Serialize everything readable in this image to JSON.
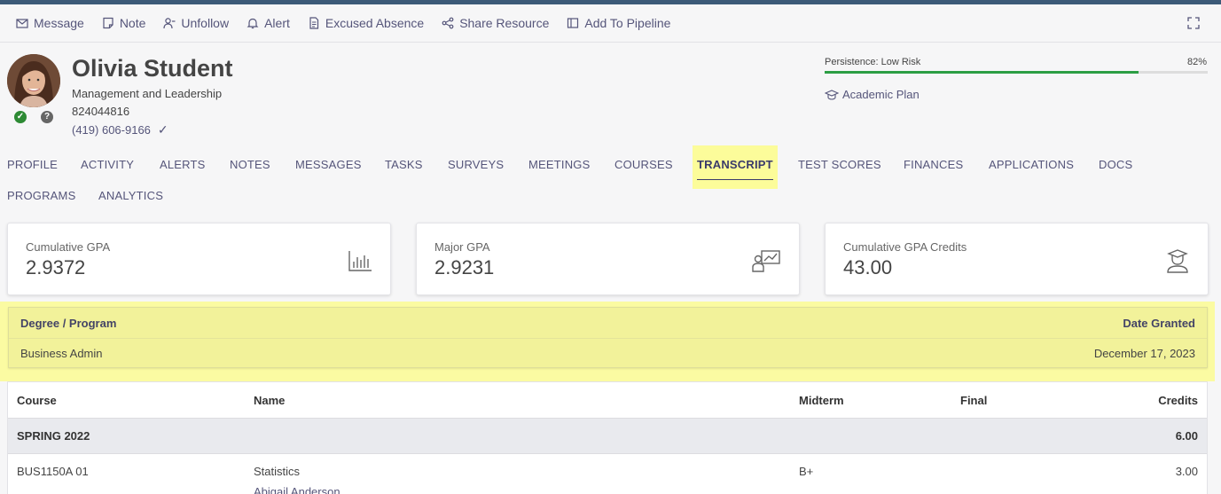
{
  "actions": [
    "Message",
    "Note",
    "Unfollow",
    "Alert",
    "Excused Absence",
    "Share Resource",
    "Add To Pipeline"
  ],
  "student": {
    "name": "Olivia Student",
    "program": "Management and Leadership",
    "id": "824044816",
    "phone": "(419) 606-9166"
  },
  "persistence": {
    "label": "Persistence: Low Risk",
    "percent_label": "82%",
    "value": 0.82,
    "color": "#2c9e44"
  },
  "academic_plan": "Academic Plan",
  "tabs": [
    "PROFILE",
    "ACTIVITY",
    "ALERTS",
    "NOTES",
    "MESSAGES",
    "TASKS",
    "SURVEYS",
    "MEETINGS",
    "COURSES",
    "TRANSCRIPT",
    "TEST SCORES",
    "FINANCES",
    "APPLICATIONS",
    "DOCS",
    "PROGRAMS",
    "ANALYTICS"
  ],
  "active_tab": "TRANSCRIPT",
  "cards": [
    {
      "label": "Cumulative GPA",
      "value": "2.9372",
      "icon": "bar-chart-icon"
    },
    {
      "label": "Major GPA",
      "value": "2.9231",
      "icon": "presentation-icon"
    },
    {
      "label": "Cumulative GPA Credits",
      "value": "43.00",
      "icon": "graduate-icon"
    }
  ],
  "degree": {
    "headers": [
      "Degree / Program",
      "Date Granted"
    ],
    "row": [
      "Business Admin",
      "December 17, 2023"
    ]
  },
  "courses": {
    "headers": [
      "Course",
      "Name",
      "Midterm",
      "Final",
      "Credits"
    ],
    "term": {
      "name": "SPRING 2022",
      "credits": "6.00"
    },
    "rows": [
      {
        "course": "BUS1150A 01",
        "name": "Statistics",
        "instructor": "Abigail Anderson",
        "midterm": "B+",
        "final": "",
        "credits": "3.00"
      }
    ]
  },
  "colors": {
    "highlight": "#fcfc9a",
    "accent": "#55557a",
    "topbar": "#3c5a78"
  }
}
